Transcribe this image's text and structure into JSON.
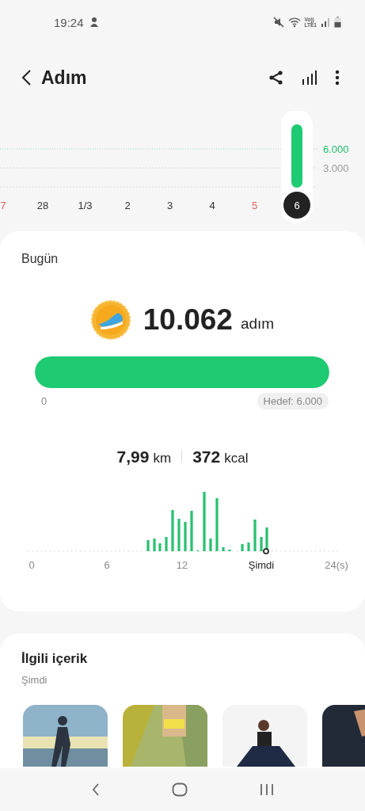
{
  "status_bar": {
    "time": "19:24",
    "network_top": "Vo))",
    "network_bottom": "LTE1"
  },
  "header": {
    "title": "Adım"
  },
  "week_chart": {
    "scale_labels": [
      {
        "label": "6.000",
        "color": "#1fbf6b"
      },
      {
        "label": "3.000",
        "color": "#9a9a9a"
      }
    ],
    "days": [
      {
        "label": "7",
        "color": "#e0605a",
        "selected": false
      },
      {
        "label": "28",
        "color": "#333333",
        "selected": false
      },
      {
        "label": "1/3",
        "color": "#333333",
        "selected": false
      },
      {
        "label": "2",
        "color": "#333333",
        "selected": false
      },
      {
        "label": "3",
        "color": "#333333",
        "selected": false
      },
      {
        "label": "4",
        "color": "#333333",
        "selected": false
      },
      {
        "label": "5",
        "color": "#e0605a",
        "selected": false
      },
      {
        "label": "6",
        "color": "#ffffff",
        "selected": true
      }
    ]
  },
  "today": {
    "title": "Bugün",
    "steps": "10.062",
    "steps_unit": "adım",
    "progress": {
      "level": 1,
      "start_label": "0",
      "goal_label": "Hedef: 6.000"
    },
    "distance": "7,99",
    "distance_unit": "km",
    "calories": "372",
    "calories_unit": "kcal",
    "hourly_axis": [
      "0",
      "6",
      "12",
      "Şimdi",
      "24(s)"
    ]
  },
  "related": {
    "title": "İlgili içerik",
    "subtitle": "Şimdi"
  }
}
